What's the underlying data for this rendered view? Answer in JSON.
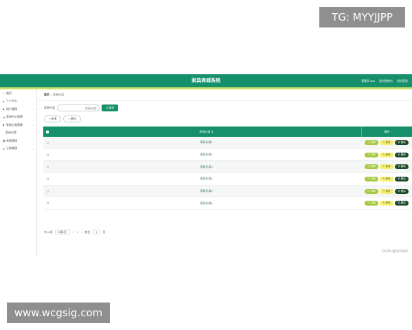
{
  "watermarks": {
    "top_right": "TG: MYYJJPP",
    "bottom_left": "www.wcgsig.com"
  },
  "header": {
    "title": "家具商城系统",
    "right_items": [
      "管理员 abo",
      "退出到前台",
      "退出登录"
    ]
  },
  "sidebar": {
    "items": [
      {
        "icon": "home-icon",
        "glyph": "⌂",
        "label": "首页",
        "chevron": ""
      },
      {
        "icon": "user-icon",
        "glyph": "●",
        "label": "个人中心",
        "chevron": "⌄"
      },
      {
        "icon": "users-icon",
        "glyph": "■",
        "label": "用户管理",
        "chevron": "⌄"
      },
      {
        "icon": "shop-icon",
        "glyph": "▲",
        "label": "家具中心管理",
        "chevron": "⌄"
      },
      {
        "icon": "category-icon",
        "glyph": "■",
        "label": "家具分类管理",
        "chevron": "⌄"
      },
      {
        "icon": "",
        "glyph": "",
        "label": "家具分类",
        "chevron": "",
        "sub": true
      },
      {
        "icon": "grid-icon",
        "glyph": "▦",
        "label": "系统管理",
        "chevron": "⌄"
      },
      {
        "icon": "order-icon",
        "glyph": "➤",
        "label": "订单管理",
        "chevron": "⌄"
      }
    ]
  },
  "breadcrumb": [
    "首页",
    "/",
    "家具分类"
  ],
  "search": {
    "label": "家具分类",
    "placeholder": "家具分类",
    "button": "Q 查询"
  },
  "actions": {
    "add": "+ 新增",
    "delete": "× 删除"
  },
  "table": {
    "headers": {
      "name": "家具分类 ⇅",
      "ops": "操作"
    },
    "rows": [
      "家具分类1",
      "家具分类2",
      "家具分类3",
      "家具分类4",
      "家具分类5",
      "家具分类6"
    ],
    "ops": {
      "view": "◎ 详情",
      "edit": "✎ 修改",
      "delete": "⊗ 删除"
    }
  },
  "pagination": {
    "total": "共 6 条",
    "page_size": "10条/页",
    "prev": "‹",
    "current": "1",
    "next": "›",
    "goto_label": "前往",
    "goto_value": "1",
    "page_suffix": "页"
  },
  "footer": {
    "credit": "CSDN @SP1092"
  },
  "colors": {
    "primary": "#16906a",
    "accent": "#c9e26a",
    "view": "#a4c93f",
    "edit": "#f4f06a",
    "delete": "#1f4a2a"
  }
}
